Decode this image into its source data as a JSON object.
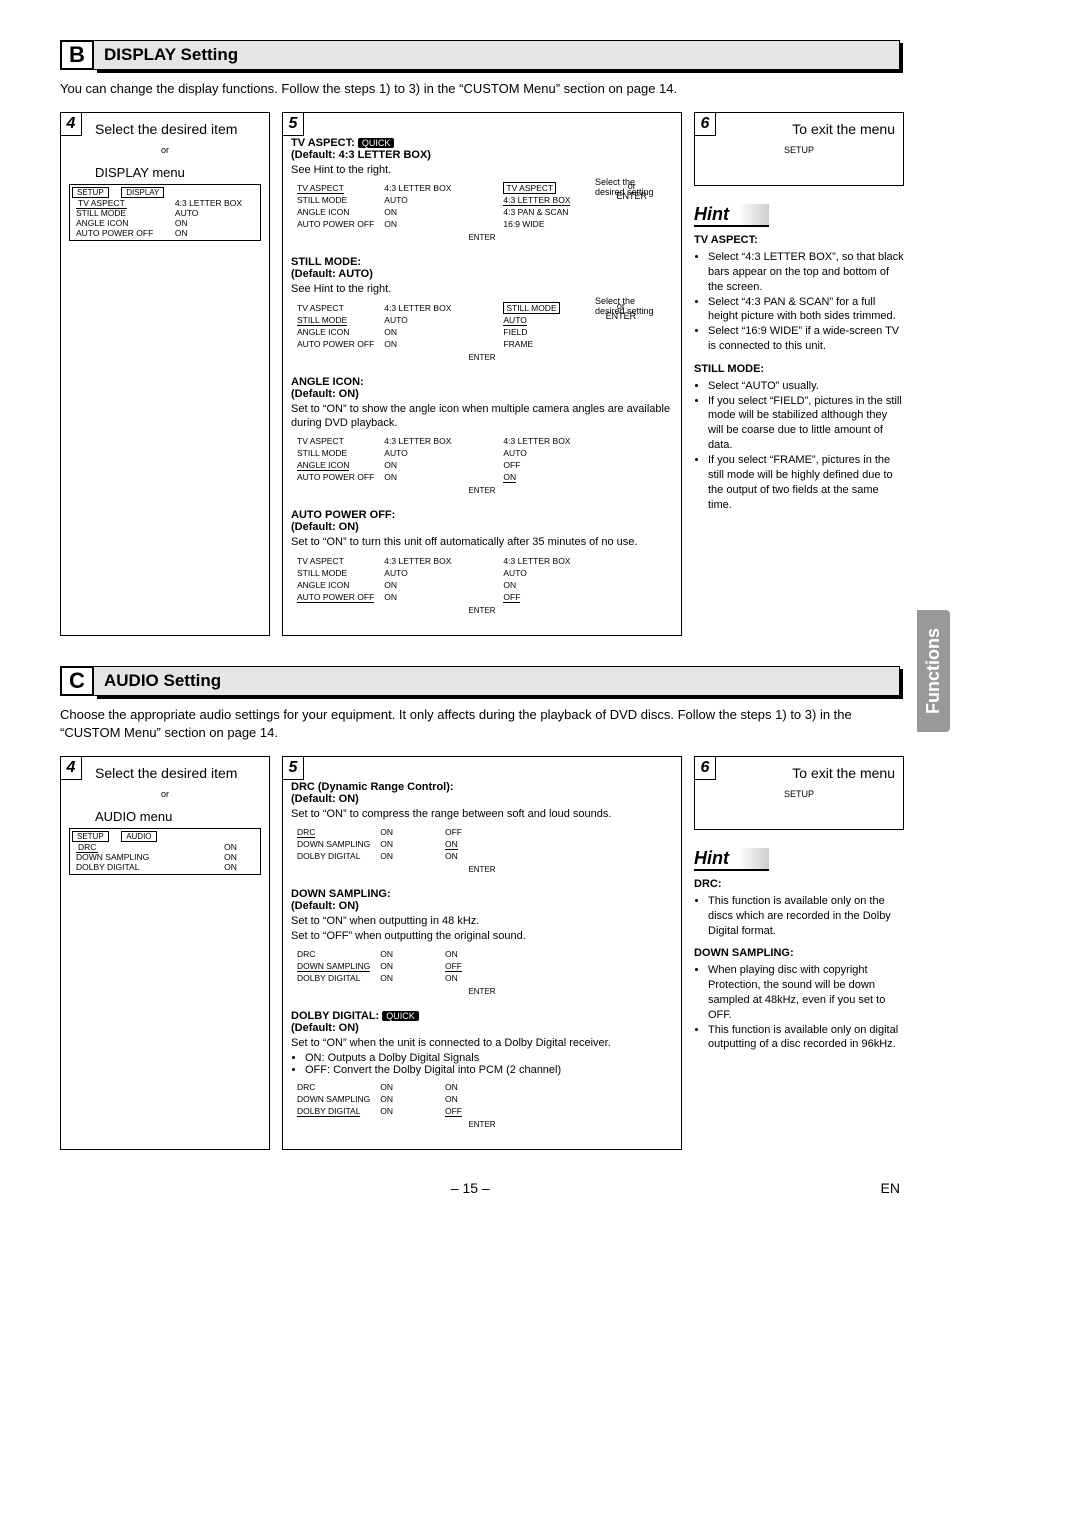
{
  "sectionB": {
    "letter": "B",
    "title": "DISPLAY Setting",
    "intro": "You can change the display functions. Follow the steps 1) to 3) in the “CUSTOM Menu” section on page 14.",
    "step4": {
      "num": "4",
      "title": "Select the desired item",
      "or": "or",
      "subhead": "DISPLAY menu",
      "menuHdrLeft": "SETUP",
      "menuHdrRight": "DISPLAY",
      "rows": [
        [
          "TV ASPECT",
          "4:3 LETTER BOX"
        ],
        [
          "STILL MODE",
          "AUTO"
        ],
        [
          "ANGLE ICON",
          "ON"
        ],
        [
          "AUTO POWER OFF",
          "ON"
        ]
      ]
    },
    "step5": {
      "num": "5",
      "items": [
        {
          "name": "TV ASPECT:",
          "quick": "QUICK",
          "def": "(Default: 4:3 LETTER BOX)",
          "desc": "See Hint to the right.",
          "sideNote": "Select the desired setting",
          "leftRows": [
            [
              "TV ASPECT",
              "4:3 LETTER BOX"
            ],
            [
              "STILL MODE",
              "AUTO"
            ],
            [
              "ANGLE ICON",
              "ON"
            ],
            [
              "AUTO POWER OFF",
              "ON"
            ]
          ],
          "rightHdr": "TV ASPECT",
          "rightRows": [
            "4:3 LETTER BOX",
            "4:3 PAN & SCAN",
            "16:9 WIDE"
          ],
          "enter": "ENTER",
          "or": "or",
          "btn": "ENTER"
        },
        {
          "name": "STILL MODE:",
          "def": "(Default: AUTO)",
          "desc": "See Hint to the right.",
          "sideNote": "Select the desired setting",
          "leftRows": [
            [
              "TV ASPECT",
              "4:3 LETTER BOX"
            ],
            [
              "STILL MODE",
              "AUTO"
            ],
            [
              "ANGLE ICON",
              "ON"
            ],
            [
              "AUTO POWER OFF",
              "ON"
            ]
          ],
          "rightHdr": "STILL MODE",
          "rightRows": [
            "AUTO",
            "FIELD",
            "FRAME"
          ],
          "enter": "ENTER",
          "or": "or",
          "btn": "ENTER"
        },
        {
          "name": "ANGLE ICON:",
          "def": "(Default: ON)",
          "desc": "Set to “ON” to show the angle icon when multiple camera angles are available during DVD playback.",
          "leftRows": [
            [
              "TV ASPECT",
              "4:3 LETTER BOX"
            ],
            [
              "STILL MODE",
              "AUTO"
            ],
            [
              "ANGLE ICON",
              "ON"
            ],
            [
              "AUTO POWER OFF",
              "ON"
            ]
          ],
          "rightRows": [
            "4:3 LETTER BOX",
            "AUTO",
            "OFF",
            "ON"
          ],
          "enter": "ENTER"
        },
        {
          "name": "AUTO POWER OFF:",
          "def": "(Default: ON)",
          "desc": "Set to “ON” to turn this unit off automatically after 35 minutes of no use.",
          "leftRows": [
            [
              "TV ASPECT",
              "4:3 LETTER BOX"
            ],
            [
              "STILL MODE",
              "AUTO"
            ],
            [
              "ANGLE ICON",
              "ON"
            ],
            [
              "AUTO POWER OFF",
              "ON"
            ]
          ],
          "rightRows": [
            "4:3 LETTER BOX",
            "AUTO",
            "ON",
            "OFF"
          ],
          "enter": "ENTER"
        }
      ]
    },
    "step6": {
      "num": "6",
      "title": "To exit the menu",
      "btn": "SETUP"
    },
    "hint": {
      "head": "Hint",
      "tvAspectHead": "TV ASPECT:",
      "tvAspect": [
        "Select “4:3 LETTER BOX”, so that black bars appear on the top and bottom of the screen.",
        "Select “4:3 PAN & SCAN” for a full height picture with both sides trimmed.",
        "Select “16:9 WIDE” if a wide-screen TV is connected to this unit."
      ],
      "stillHead": "STILL MODE:",
      "still": [
        "Select “AUTO” usually.",
        "If you select “FIELD”, pictures in the still mode will be stabilized although they will be coarse due to little amount of data.",
        "If you select “FRAME”, pictures in the still mode will be highly defined due to the output of two fields at the same time."
      ]
    }
  },
  "sectionC": {
    "letter": "C",
    "title": "AUDIO Setting",
    "intro": "Choose the appropriate audio settings for your equipment. It only affects during the playback of DVD discs. Follow the steps 1) to 3) in the “CUSTOM Menu” section on page 14.",
    "step4": {
      "num": "4",
      "title": "Select the desired item",
      "or": "or",
      "subhead": "AUDIO menu",
      "menuHdrLeft": "SETUP",
      "menuHdrRight": "AUDIO",
      "rows": [
        [
          "DRC",
          "ON"
        ],
        [
          "DOWN SAMPLING",
          "ON"
        ],
        [
          "DOLBY DIGITAL",
          "ON"
        ]
      ]
    },
    "step5": {
      "num": "5",
      "items": [
        {
          "name": "DRC (Dynamic Range Control):",
          "def": "(Default: ON)",
          "desc": "Set to “ON” to compress the range between soft and loud sounds.",
          "leftRows": [
            [
              "DRC",
              "ON"
            ],
            [
              "DOWN SAMPLING",
              "ON"
            ],
            [
              "DOLBY DIGITAL",
              "ON"
            ]
          ],
          "rightRows": [
            "OFF",
            "ON",
            "ON"
          ],
          "enter": "ENTER"
        },
        {
          "name": "DOWN SAMPLING:",
          "def": "(Default: ON)",
          "desc": "Set to “ON” when outputting in 48 kHz.\nSet to “OFF” when outputting the original sound.",
          "leftRows": [
            [
              "DRC",
              "ON"
            ],
            [
              "DOWN SAMPLING",
              "ON"
            ],
            [
              "DOLBY DIGITAL",
              "ON"
            ]
          ],
          "rightRows": [
            "ON",
            "OFF",
            "ON"
          ],
          "enter": "ENTER"
        },
        {
          "name": "DOLBY DIGITAL:",
          "quick": "QUICK",
          "def": "(Default: ON)",
          "desc": "Set to “ON” when the unit is connected to a Dolby Digital receiver.",
          "bullets": [
            "ON: Outputs a Dolby Digital Signals",
            "OFF: Convert the Dolby Digital into PCM (2 channel)"
          ],
          "leftRows": [
            [
              "DRC",
              "ON"
            ],
            [
              "DOWN SAMPLING",
              "ON"
            ],
            [
              "DOLBY DIGITAL",
              "ON"
            ]
          ],
          "rightRows": [
            "ON",
            "ON",
            "OFF"
          ],
          "enter": "ENTER"
        }
      ]
    },
    "step6": {
      "num": "6",
      "title": "To exit the menu",
      "btn": "SETUP"
    },
    "hint": {
      "head": "Hint",
      "drcHead": "DRC:",
      "drc": [
        "This function is available only on the discs which are recorded in the Dolby Digital format."
      ],
      "dsHead": "DOWN SAMPLING:",
      "ds": [
        "When playing disc with copyright Protection, the sound will be down sampled at 48kHz, even if you set to OFF.",
        "This function is available only on digital outputting of a disc recorded in 96kHz."
      ]
    }
  },
  "sideTab": "Functions",
  "footer": {
    "page": "– 15 –",
    "lang": "EN"
  }
}
